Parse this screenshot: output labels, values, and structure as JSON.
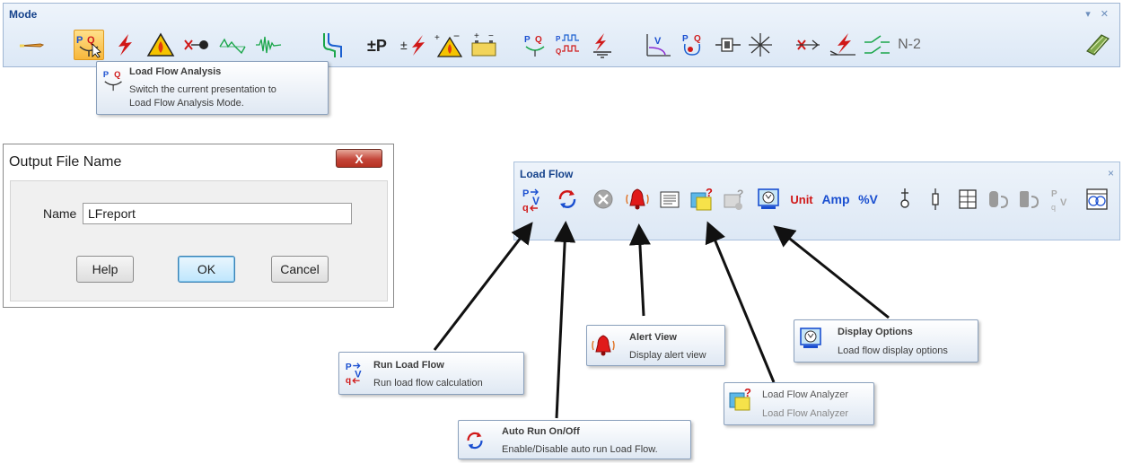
{
  "mode_toolbar": {
    "title": "Mode",
    "window_controls": "▾ ✕",
    "n2_label": "N-2",
    "icons": [
      "edit-mode-icon",
      "load-flow-analysis-icon",
      "short-circuit-icon",
      "arc-flash-icon",
      "motor-acceleration-icon",
      "harmonic-analysis-icon",
      "transient-stability-icon",
      "protective-coordination-icon",
      "optimal-power-flow-icon",
      "reliability-icon",
      "dc-arc-flash-icon",
      "battery-sizing-icon",
      "unbalanced-load-flow-icon",
      "dc-load-flow-icon",
      "ground-grid-icon",
      "voltage-stability-icon",
      "optimal-capacitor-placement-icon",
      "cable-pulling-icon",
      "panel-system-icon",
      "contingency-analysis-icon",
      "dc-short-circuit-icon",
      "switching-sequence-icon",
      "n-2-analysis-icon",
      "scenario-wizard-icon"
    ]
  },
  "mode_tooltip": {
    "title": "Load Flow Analysis",
    "desc_line1": "Switch the current presentation to",
    "desc_line2": "Load Flow Analysis Mode."
  },
  "dialog": {
    "title": "Output File Name",
    "close_label": "X",
    "name_label": "Name",
    "name_value": "LFreport",
    "help_label": "Help",
    "ok_label": "OK",
    "cancel_label": "Cancel"
  },
  "lf_toolbar": {
    "title": "Load Flow",
    "close_label": "×",
    "unit_label": "Unit",
    "amp_label": "Amp",
    "pctv_label": "%V"
  },
  "tooltips": {
    "run": {
      "title": "Run Load Flow",
      "desc": "Run load flow calculation"
    },
    "auto": {
      "title": "Auto Run On/Off",
      "desc": "Enable/Disable auto run Load Flow."
    },
    "alert": {
      "title": "Alert View",
      "desc": "Display alert view"
    },
    "analyzer": {
      "title": "Load Flow Analyzer",
      "desc": "Load Flow Analyzer"
    },
    "display": {
      "title": "Display Options",
      "desc": "Load flow display options"
    }
  }
}
